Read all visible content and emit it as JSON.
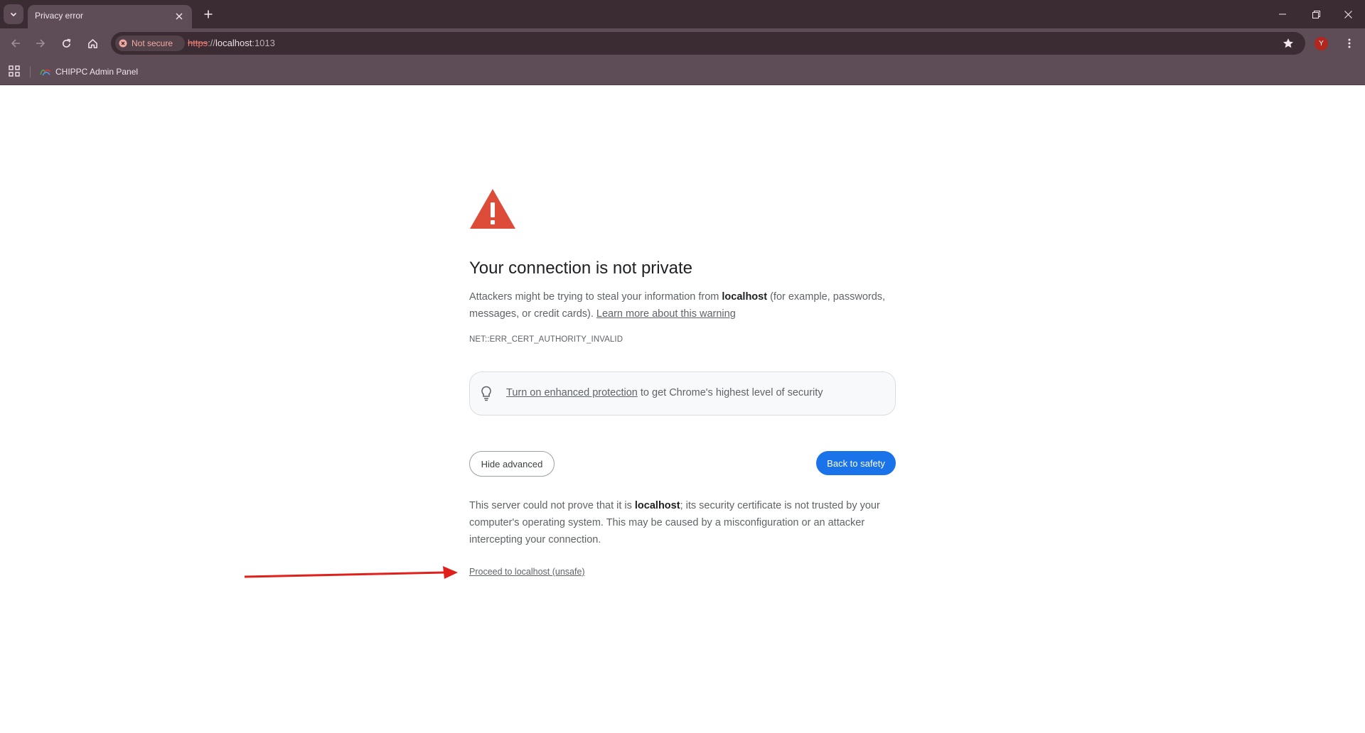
{
  "browser": {
    "tab": {
      "title": "Privacy error"
    },
    "omnibox": {
      "security_chip": "Not secure",
      "url_scheme": "https",
      "url_separator": "://",
      "url_host": "localhost",
      "url_port": ":1013"
    },
    "profile_initial": "Y",
    "bookmarks": [
      {
        "label": "CHIPPC Admin Panel"
      }
    ]
  },
  "interstitial": {
    "heading": "Your connection is not private",
    "intro_before": "Attackers might be trying to steal your information from ",
    "intro_host": "localhost",
    "intro_after": " (for example, passwords, messages, or credit cards). ",
    "learn_more": "Learn more about this warning",
    "error_code": "NET::ERR_CERT_AUTHORITY_INVALID",
    "protection_link": "Turn on enhanced protection",
    "protection_text": " to get Chrome's highest level of security",
    "hide_advanced": "Hide advanced",
    "back_to_safety": "Back to safety",
    "details_before": "This server could not prove that it is ",
    "details_host": "localhost",
    "details_after": "; its security certificate is not trusted by your computer's operating system. This may be caused by a misconfiguration or an attacker intercepting your connection.",
    "proceed_link": "Proceed to localhost (unsafe)"
  },
  "colors": {
    "warning_red": "#dd4b39",
    "primary_button": "#1a73e8",
    "annotation_arrow": "#e0201b"
  }
}
